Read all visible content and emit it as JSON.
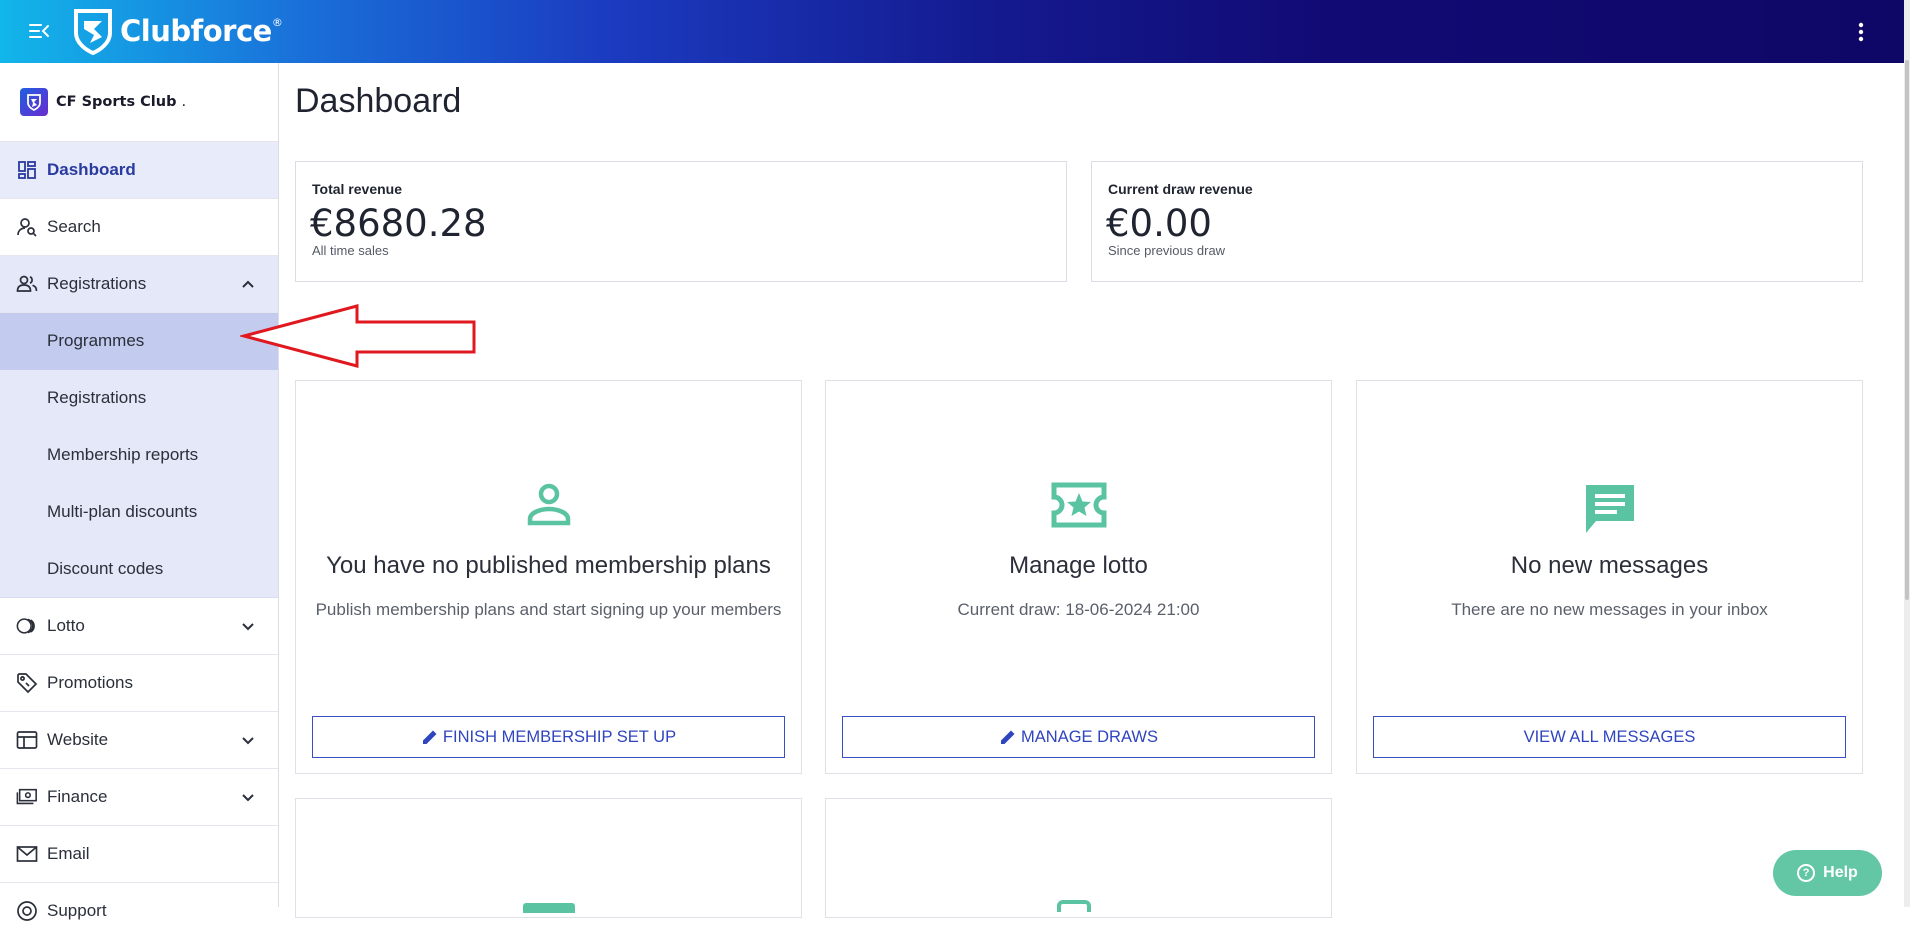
{
  "app": {
    "brand": "Clubforce",
    "brand_mark": "®"
  },
  "club": {
    "name": "CF Sports Club",
    "suffix": "."
  },
  "sidebar": {
    "items": [
      {
        "label": "Dashboard",
        "icon": "dashboard-icon",
        "active": true
      },
      {
        "label": "Search",
        "icon": "person-search-icon"
      },
      {
        "label": "Registrations",
        "icon": "people-icon",
        "expanded": true,
        "children": [
          {
            "label": "Programmes",
            "selected": true
          },
          {
            "label": "Registrations"
          },
          {
            "label": "Membership reports"
          },
          {
            "label": "Multi-plan discounts"
          },
          {
            "label": "Discount codes"
          }
        ]
      },
      {
        "label": "Lotto",
        "icon": "lotto-icon",
        "expandable": true
      },
      {
        "label": "Promotions",
        "icon": "tag-icon"
      },
      {
        "label": "Website",
        "icon": "website-icon",
        "expandable": true
      },
      {
        "label": "Finance",
        "icon": "money-icon",
        "expandable": true
      },
      {
        "label": "Email",
        "icon": "mail-icon"
      },
      {
        "label": "Support",
        "icon": "support-icon"
      }
    ]
  },
  "main": {
    "title": "Dashboard",
    "stats": [
      {
        "label": "Total revenue",
        "value": "€8680.28",
        "sub": "All time sales"
      },
      {
        "label": "Current draw revenue",
        "value": "€0.00",
        "sub": "Since previous draw"
      }
    ],
    "tiles": [
      {
        "title": "You have no published membership plans",
        "sub": "Publish membership plans and start signing up your members",
        "button": "FINISH MEMBERSHIP SET UP",
        "icon": "person-icon"
      },
      {
        "title": "Manage lotto",
        "sub": "Current draw: 18-06-2024 21:00",
        "button": "MANAGE DRAWS",
        "icon": "ticket-icon"
      },
      {
        "title": "No new messages",
        "sub": "There are no new messages in your inbox",
        "button": "VIEW ALL MESSAGES",
        "icon": "message-icon"
      }
    ]
  },
  "help": {
    "label": "Help"
  },
  "colors": {
    "accent": "#2f45bf",
    "icon_green": "#5ac3a1",
    "selected_bg": "#c3cbef",
    "annotation": "#e0181f"
  }
}
